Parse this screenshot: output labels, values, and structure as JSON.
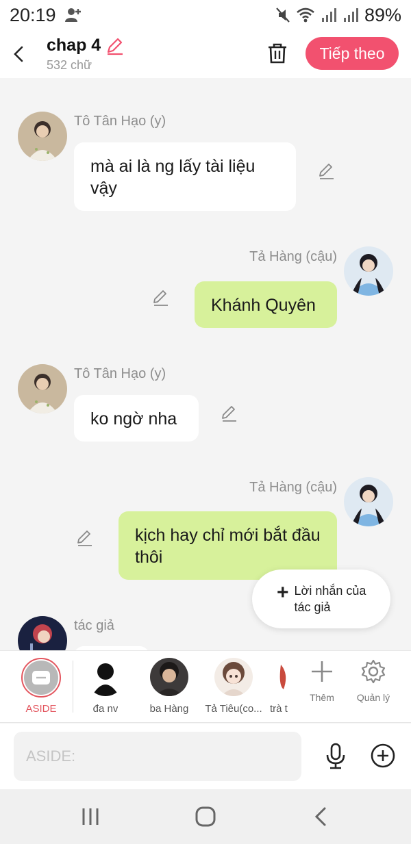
{
  "status_bar": {
    "time": "20:19",
    "battery": "89%"
  },
  "header": {
    "chapter_title": "chap 4",
    "word_count": "532 chữ",
    "next_button": "Tiếp theo"
  },
  "messages": [
    {
      "sender": "Tô Tân Hạo (y)",
      "text": "mà ai là ng lấy tài liệu vậy"
    },
    {
      "sender": "Tả Hàng (cậu)",
      "text": "Khánh Quyên"
    },
    {
      "sender": "Tô Tân Hạo (y)",
      "text": "ko ngờ nha"
    },
    {
      "sender": "Tả Hàng (cậu)",
      "text": "kịch hay chỉ mới bắt đầu thôi"
    },
    {
      "sender": "tác giả",
      "text": ""
    }
  ],
  "floating_button": {
    "label": "Lời nhắn của tác giả"
  },
  "characters": [
    {
      "name": "ASIDE"
    },
    {
      "name": "đa nv"
    },
    {
      "name": "ba Hàng"
    },
    {
      "name": "Tả Tiêu(co..."
    },
    {
      "name": "trà t"
    }
  ],
  "tools": {
    "add_label": "Thêm",
    "manage_label": "Quản lý"
  },
  "input": {
    "placeholder": "ASIDE:"
  },
  "colors": {
    "accent": "#f2516f",
    "bubble_right": "#d7f19b",
    "aside_red": "#e3565f"
  }
}
